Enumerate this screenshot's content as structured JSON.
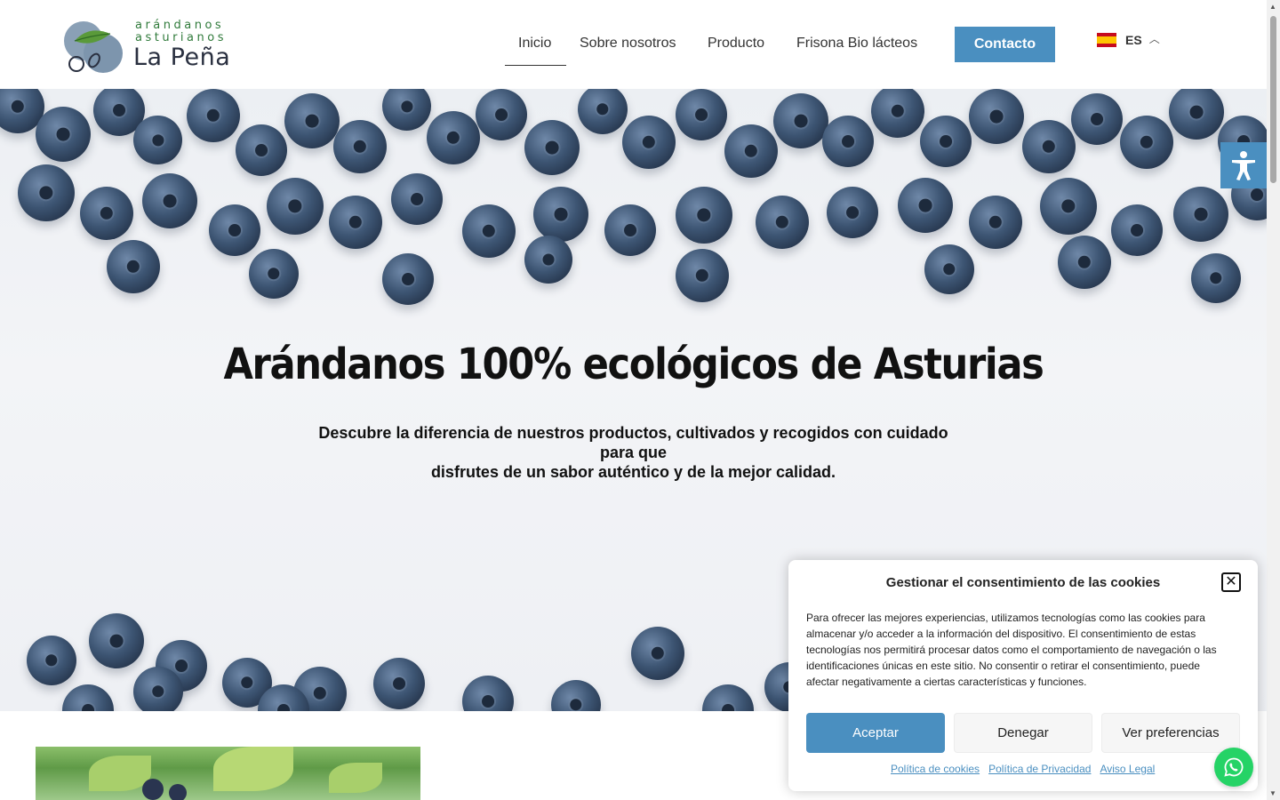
{
  "logo": {
    "line1": "arándanos",
    "line2": "asturianos",
    "name": "La Peña"
  },
  "nav": {
    "items": [
      {
        "label": "Inicio",
        "active": true
      },
      {
        "label": "Sobre nosotros",
        "active": false
      },
      {
        "label": "Producto",
        "active": false
      },
      {
        "label": "Frisona Bio lácteos",
        "active": false
      }
    ],
    "contact_label": "Contacto"
  },
  "language": {
    "code": "ES",
    "flag": "spain-flag-icon"
  },
  "hero": {
    "title": "Arándanos 100% ecológicos de Asturias",
    "subtitle_line1": "Descubre la diferencia de nuestros productos, cultivados y recogidos con cuidado para que",
    "subtitle_line2": "disfrutes de un sabor auténtico y de la mejor calidad."
  },
  "cookie": {
    "title": "Gestionar el consentimiento de las cookies",
    "text": "Para ofrecer las mejores experiencias, utilizamos tecnologías como las cookies para almacenar y/o acceder a la información del dispositivo. El consentimiento de estas tecnologías nos permitirá procesar datos como el comportamiento de navegación o las identificaciones únicas en este sitio. No consentir o retirar el consentimiento, puede afectar negativamente a ciertas características y funciones.",
    "accept_label": "Aceptar",
    "deny_label": "Denegar",
    "prefs_label": "Ver preferencias",
    "links": [
      "Política de cookies",
      "Política de Privacidad",
      "Aviso Legal"
    ]
  },
  "colors": {
    "accent": "#4a8fc0",
    "whatsapp": "#25d366",
    "logo_green": "#2f7a3a"
  },
  "icons": {
    "accessibility": "accessibility-icon",
    "whatsapp": "whatsapp-icon",
    "close": "close-icon",
    "caret": "chevron-up-icon"
  }
}
